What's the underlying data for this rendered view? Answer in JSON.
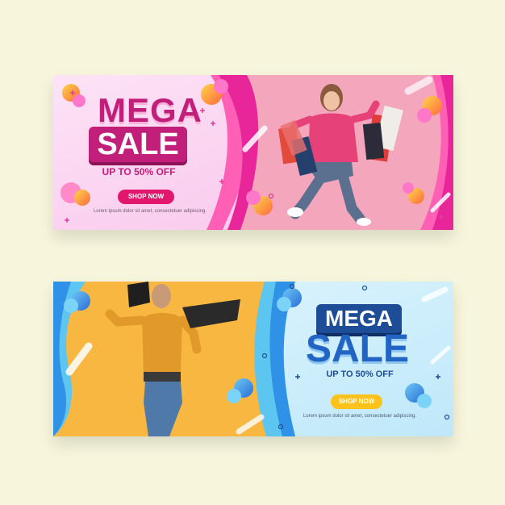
{
  "banners": [
    {
      "title_line1": "MEGA",
      "title_line2": "SALE",
      "discount": "UP TO 50% OFF",
      "button": "SHOP NOW",
      "lorem": "Lorem ipsum dolor sit amet, consectetuer adipiscing.",
      "colors": {
        "accent": "#c21f7a",
        "background": "#fbd3f2",
        "photo_bg": "#f4a6bd",
        "button": "#e3166e"
      }
    },
    {
      "title_line1": "MEGA",
      "title_line2": "SALE",
      "discount": "UP TO 50% OFF",
      "button": "SHOP NOW",
      "lorem": "Lorem ipsum dolor sit amet, consectetuer adipiscing.",
      "colors": {
        "accent": "#1d4d96",
        "background": "#cdeefb",
        "photo_bg": "#f8b740",
        "button": "#ffc21a"
      }
    }
  ]
}
